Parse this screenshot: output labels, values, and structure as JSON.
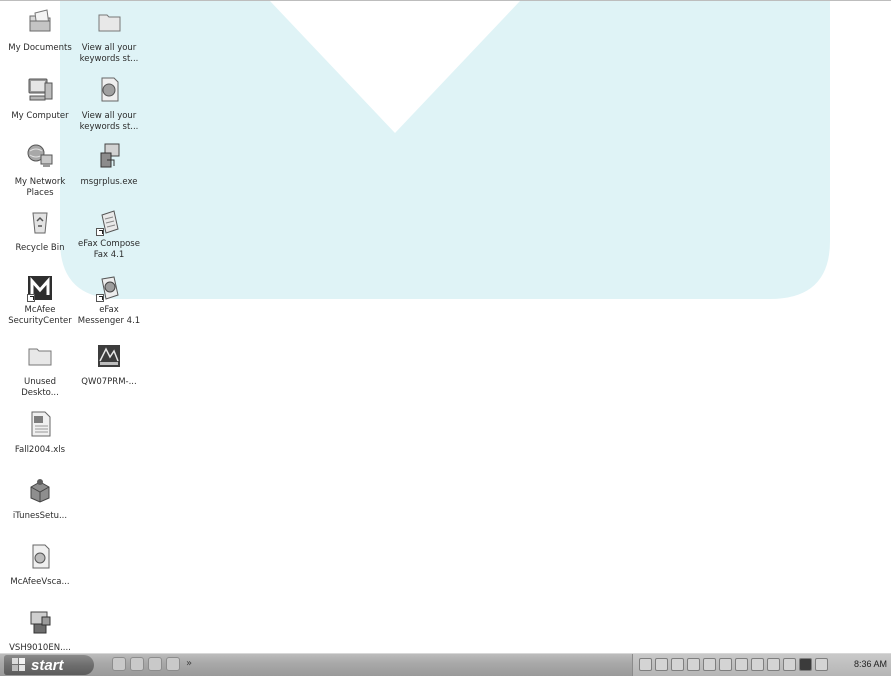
{
  "desktop": {
    "icons": [
      {
        "label": "My Documents"
      },
      {
        "label": "View all your\nkeywords st..."
      },
      {
        "label": "My Computer"
      },
      {
        "label": "View all your\nkeywords st..."
      },
      {
        "label": "My Network\nPlaces"
      },
      {
        "label": "msgrplus.exe"
      },
      {
        "label": "Recycle Bin"
      },
      {
        "label": "eFax Compose\nFax 4.1"
      },
      {
        "label": "McAfee\nSecurityCenter"
      },
      {
        "label": "eFax\nMessenger 4.1"
      },
      {
        "label": "Unused\nDeskto..."
      },
      {
        "label": "QW07PRM-..."
      },
      {
        "label": "Fall2004.xls"
      },
      {
        "label": "iTunesSetu..."
      },
      {
        "label": "McAfeeVsca..."
      },
      {
        "label": "VSH9010EN...."
      }
    ]
  },
  "taskbar": {
    "start_label": "start",
    "clock": "8:36 AM"
  },
  "colors": {
    "wallpaper_accent": "#dff3f6",
    "taskbar": "#a9a9a9"
  }
}
